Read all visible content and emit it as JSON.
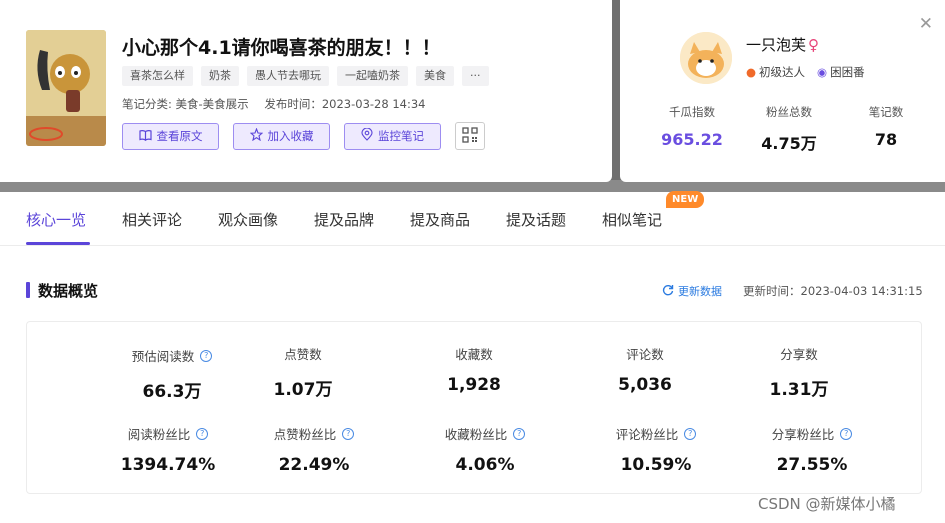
{
  "note": {
    "title": "小心那个4.1请你喝喜茶的朋友！！！",
    "tags": [
      "喜茶怎么样",
      "奶茶",
      "愚人节去哪玩",
      "一起嗑奶茶",
      "美食",
      "···"
    ],
    "category": "笔记分类: 美食-美食展示",
    "published": "发布时间：2023-03-28 14:34",
    "actions": {
      "view_original": "查看原文",
      "add_favorite": "加入收藏",
      "monitor_note": "监控笔记"
    }
  },
  "author": {
    "name": "一只泡芙",
    "gender_symbol": "♀",
    "level": "初级达人",
    "group": "困困番",
    "stats": [
      {
        "label": "千瓜指数",
        "value": "965.22"
      },
      {
        "label": "粉丝总数",
        "value": "4.75万"
      },
      {
        "label": "笔记数",
        "value": "78"
      }
    ]
  },
  "tabs": [
    {
      "label": "核心一览",
      "active": true
    },
    {
      "label": "相关评论"
    },
    {
      "label": "观众画像"
    },
    {
      "label": "提及品牌"
    },
    {
      "label": "提及商品"
    },
    {
      "label": "提及话题"
    },
    {
      "label": "相似笔记"
    }
  ],
  "new_badge": "NEW",
  "overview": {
    "title": "数据概览",
    "refresh_label": "更新数据",
    "updated_at": "更新时间：2023-04-03 14:31:15",
    "row1": [
      {
        "label": "预估阅读数",
        "value": "66.3万",
        "help": true
      },
      {
        "label": "点赞数",
        "value": "1.07万",
        "help": false
      },
      {
        "label": "收藏数",
        "value": "1,928",
        "help": false
      },
      {
        "label": "评论数",
        "value": "5,036",
        "help": false
      },
      {
        "label": "分享数",
        "value": "1.31万",
        "help": false
      }
    ],
    "row2": [
      {
        "label": "阅读粉丝比",
        "value": "1394.74%",
        "help": true
      },
      {
        "label": "点赞粉丝比",
        "value": "22.49%",
        "help": true
      },
      {
        "label": "收藏粉丝比",
        "value": "4.06%",
        "help": true
      },
      {
        "label": "评论粉丝比",
        "value": "10.59%",
        "help": true
      },
      {
        "label": "分享粉丝比",
        "value": "27.55%",
        "help": true
      }
    ]
  },
  "watermark": "CSDN @新媒体小橘",
  "colors": {
    "accent": "#5b45d9",
    "link": "#2b7be0",
    "badge": "#ff8a2a"
  }
}
